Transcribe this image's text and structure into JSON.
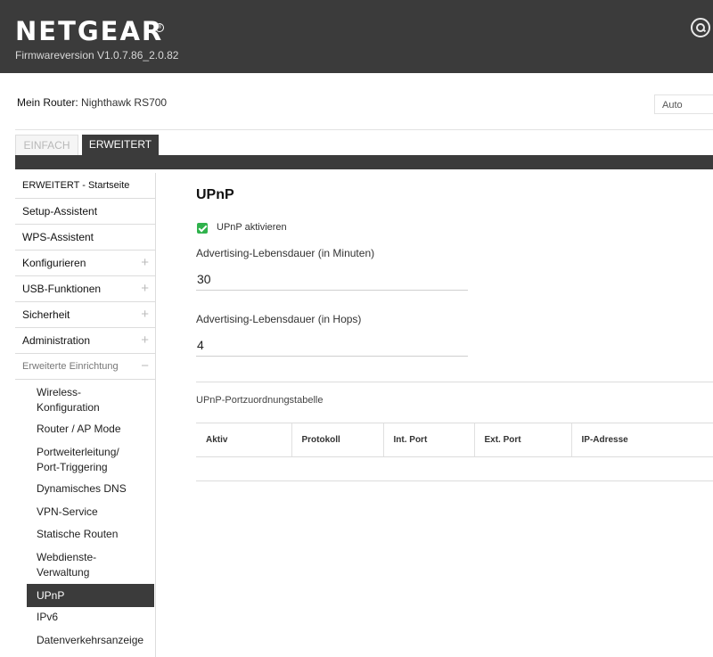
{
  "header": {
    "brand": "NETGEAR",
    "registered_mark": "®",
    "firmware": "Firmwareversion V1.0.7.86_2.0.82",
    "search_icon": "search-icon"
  },
  "router": {
    "label": "Mein Router:",
    "model": "Nighthawk RS700"
  },
  "language_select": {
    "value": "Auto"
  },
  "mode_tabs": {
    "simple": "EINFACH",
    "advanced": "ERWEITERT"
  },
  "sidebar": {
    "items": [
      {
        "label": "ERWEITERT - Startseite",
        "expandable": false
      },
      {
        "label": "Setup-Assistent",
        "expandable": false
      },
      {
        "label": "WPS-Assistent",
        "expandable": false
      },
      {
        "label": "Konfigurieren",
        "expandable": true
      },
      {
        "label": "USB-Funktionen",
        "expandable": true
      },
      {
        "label": "Sicherheit",
        "expandable": true
      },
      {
        "label": "Administration",
        "expandable": true
      },
      {
        "label": "Erweiterte Einrichtung",
        "expandable": true,
        "expanded": true
      }
    ],
    "expand_symbol": "+",
    "collapse_symbol": "−",
    "subitems": [
      {
        "line1": "Wireless-",
        "line2": "Konfiguration"
      },
      {
        "line1": "Router / AP Mode",
        "line2": ""
      },
      {
        "line1": "Portweiterleitung/",
        "line2": "Port-Triggering"
      },
      {
        "line1": "Dynamisches DNS",
        "line2": ""
      },
      {
        "line1": "VPN-Service",
        "line2": ""
      },
      {
        "line1": "Statische Routen",
        "line2": ""
      },
      {
        "line1": "Webdienste-",
        "line2": "Verwaltung"
      },
      {
        "line1": "UPnP",
        "line2": "",
        "active": true
      },
      {
        "line1": "IPv6",
        "line2": ""
      },
      {
        "line1": "Datenverkehrsanzeige",
        "line2": ""
      }
    ]
  },
  "main": {
    "title": "UPnP",
    "enable_upnp": {
      "label": "UPnP aktivieren",
      "checked": true,
      "color": "#2fb24c"
    },
    "lifetime_minutes": {
      "label": "Advertising-Lebensdauer (in Minuten)",
      "value": "30"
    },
    "lifetime_hops": {
      "label": "Advertising-Lebensdauer (in Hops)",
      "value": "4"
    },
    "table": {
      "caption": "UPnP-Portzuordnungstabelle",
      "columns": [
        "Aktiv",
        "Protokoll",
        "Int. Port",
        "Ext. Port",
        "IP-Adresse"
      ],
      "rows": []
    }
  },
  "colors": {
    "header_bg": "#3b3b3b",
    "accent_green": "#2fb24c",
    "active_nav_bg": "#3b3b3b"
  }
}
